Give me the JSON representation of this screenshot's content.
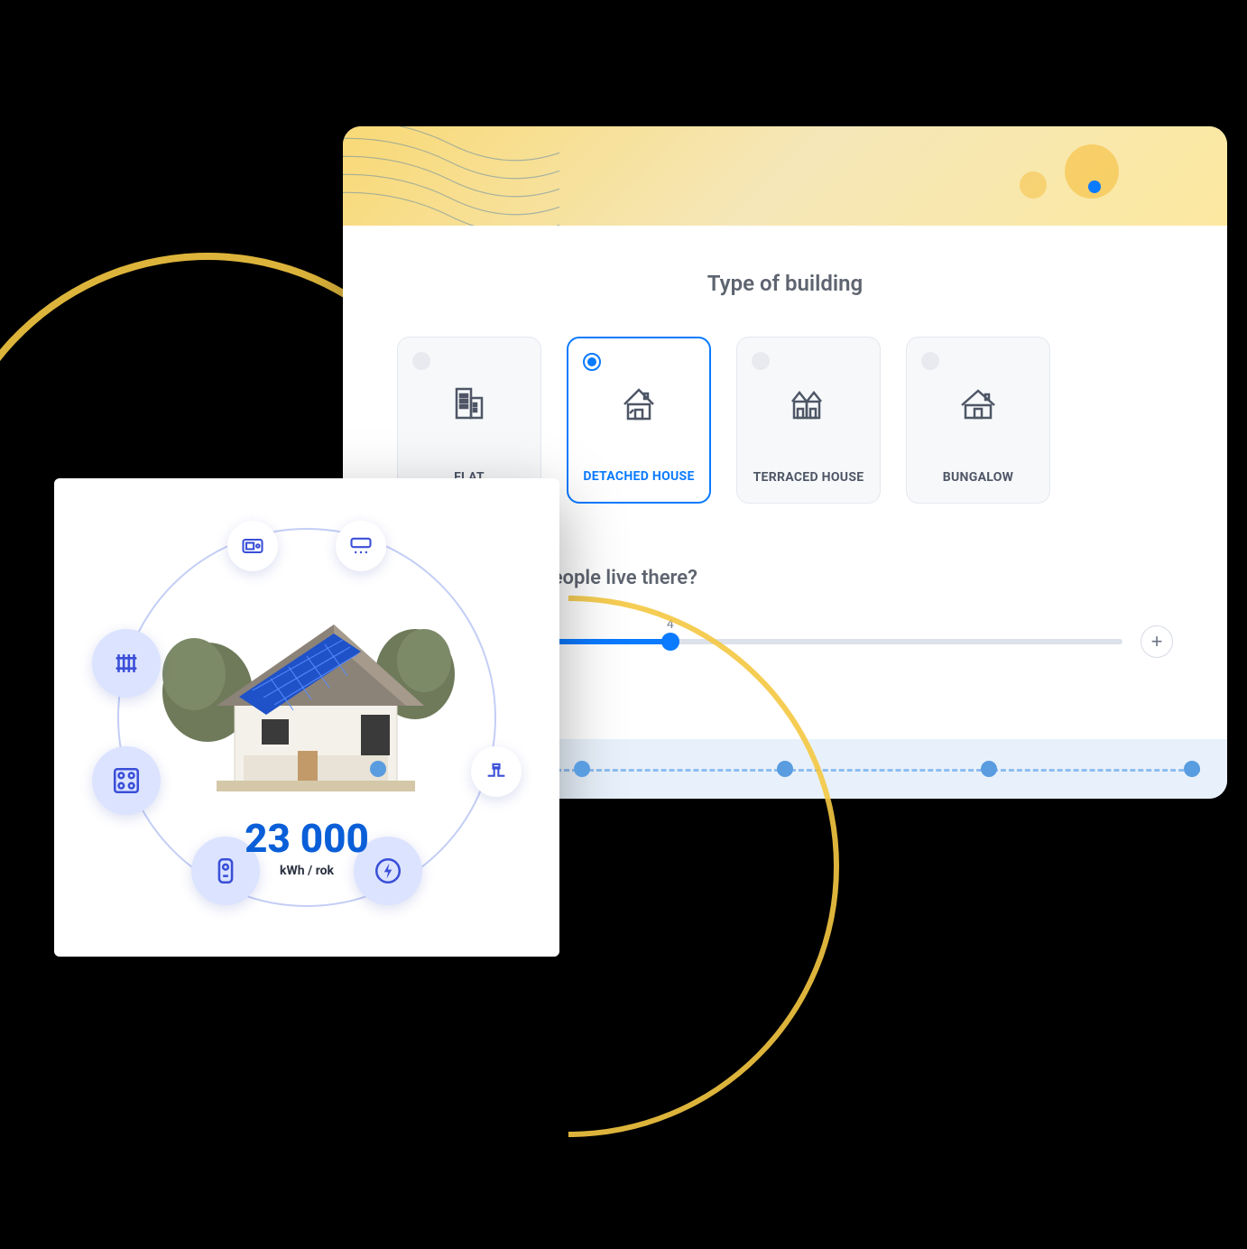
{
  "config": {
    "title": "Type of building",
    "options": [
      {
        "id": "flat",
        "label": "FLAT",
        "icon": "flat-building-icon",
        "selected": false
      },
      {
        "id": "detached",
        "label": "DETACHED HOUSE",
        "icon": "detached-house-icon",
        "selected": true
      },
      {
        "id": "terraced",
        "label": "TERRACED HOUSE",
        "icon": "terraced-house-icon",
        "selected": false
      },
      {
        "id": "bungalow",
        "label": "BUNGALOW",
        "icon": "bungalow-icon",
        "selected": false
      }
    ],
    "slider": {
      "title": "How many people live there?",
      "value": "4",
      "minus_label": "−",
      "plus_label": "+"
    },
    "progress_steps": 5
  },
  "energy": {
    "value": "23 000",
    "unit": "kWh / rok",
    "appliance_icons": [
      "microwave-icon",
      "ac-icon",
      "radiator-icon",
      "cooktop-icon",
      "pipe-icon",
      "waterheater-icon",
      "power-icon"
    ]
  },
  "colors": {
    "accent": "#0a7aff",
    "accent_dark": "#0a5fd8",
    "yellow": "#f5c842"
  }
}
